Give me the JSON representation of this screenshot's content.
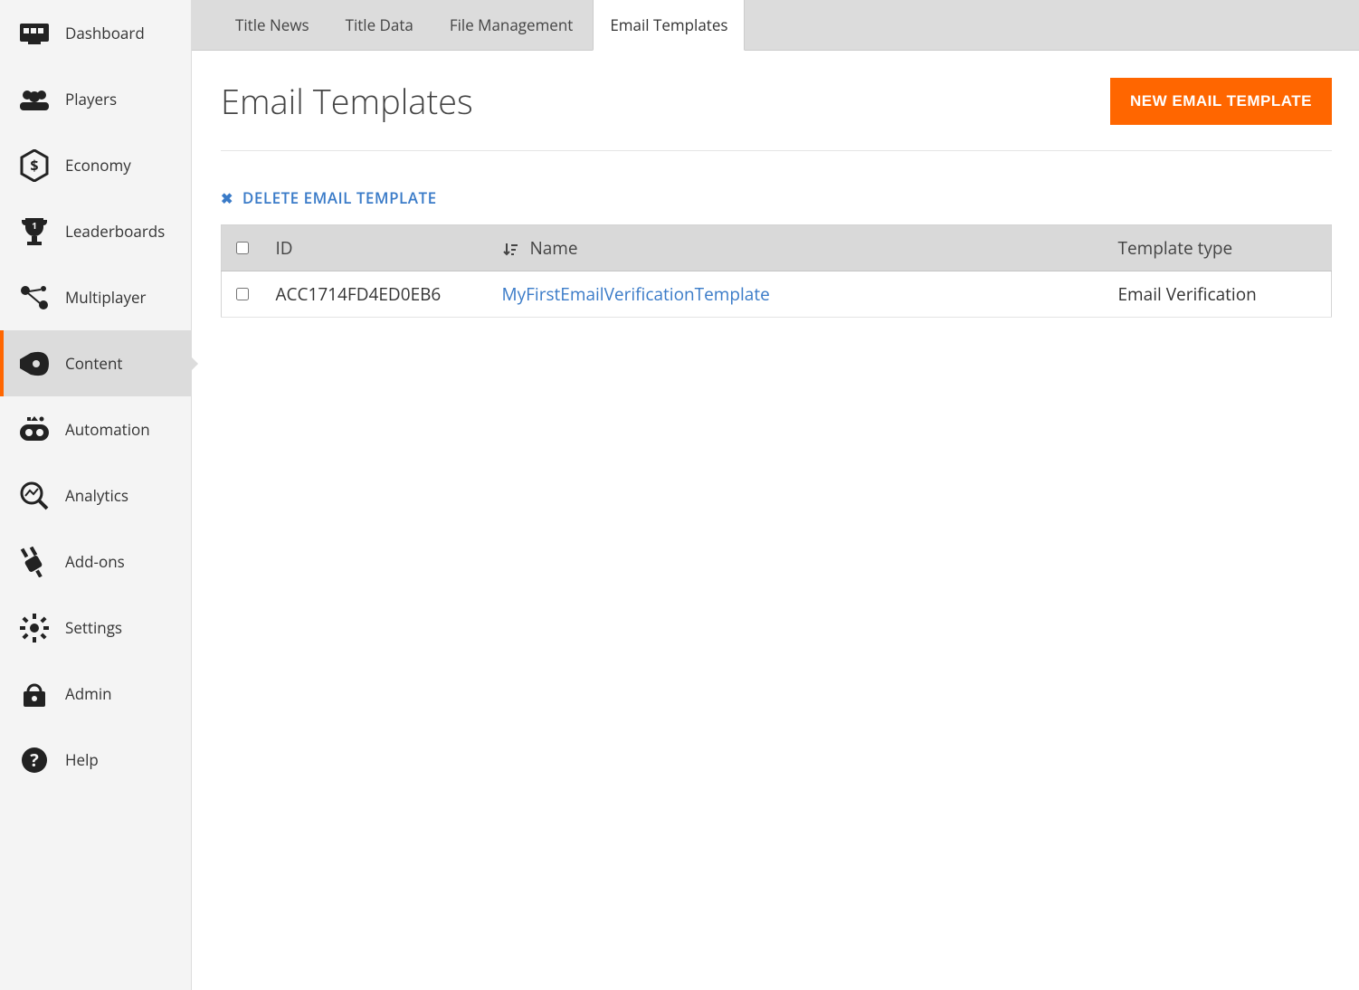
{
  "sidebar": {
    "items": [
      {
        "label": "Dashboard"
      },
      {
        "label": "Players"
      },
      {
        "label": "Economy"
      },
      {
        "label": "Leaderboards"
      },
      {
        "label": "Multiplayer"
      },
      {
        "label": "Content"
      },
      {
        "label": "Automation"
      },
      {
        "label": "Analytics"
      },
      {
        "label": "Add-ons"
      },
      {
        "label": "Settings"
      },
      {
        "label": "Admin"
      },
      {
        "label": "Help"
      }
    ]
  },
  "tabs": [
    {
      "label": "Title News"
    },
    {
      "label": "Title Data"
    },
    {
      "label": "File Management"
    },
    {
      "label": "Email Templates"
    }
  ],
  "page": {
    "title": "Email Templates",
    "new_button": "NEW EMAIL TEMPLATE",
    "delete_action": "DELETE EMAIL TEMPLATE"
  },
  "table": {
    "headers": {
      "id": "ID",
      "name": "Name",
      "type": "Template type"
    },
    "rows": [
      {
        "id": "ACC1714FD4ED0EB6",
        "name": "MyFirstEmailVerificationTemplate",
        "type": "Email Verification"
      }
    ]
  }
}
